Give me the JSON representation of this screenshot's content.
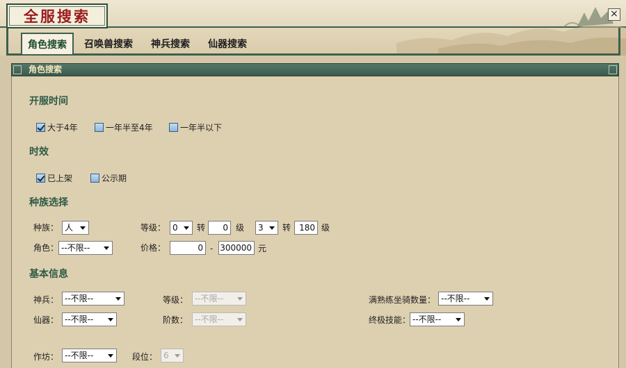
{
  "header": {
    "title": "全服搜索"
  },
  "tabs": [
    {
      "label": "角色搜索",
      "active": true
    },
    {
      "label": "召唤兽搜索",
      "active": false
    },
    {
      "label": "神兵搜索",
      "active": false
    },
    {
      "label": "仙器搜索",
      "active": false
    }
  ],
  "section": {
    "title": "角色搜索"
  },
  "open_time": {
    "title": "开服时间",
    "options": [
      {
        "label": "大于4年",
        "checked": true
      },
      {
        "label": "一年半至4年",
        "checked": false
      },
      {
        "label": "一年半以下",
        "checked": false
      }
    ]
  },
  "validity": {
    "title": "时效",
    "options": [
      {
        "label": "已上架",
        "checked": true
      },
      {
        "label": "公示期",
        "checked": false
      }
    ]
  },
  "race_select": {
    "title": "种族选择",
    "race_label": "种族：",
    "race_value": "人",
    "level_label": "等级：",
    "level_from_turn": "0",
    "turn_text": "转",
    "level_from": "0",
    "grade_text": "级",
    "level_to_turn": "3",
    "level_to": "180",
    "role_label": "角色：",
    "role_value": "--不限--",
    "price_label": "价格：",
    "price_min": "0",
    "price_sep": "-",
    "price_max": "300000",
    "currency": "元"
  },
  "basic_info": {
    "title": "基本信息",
    "weapon_label": "神兵：",
    "weapon_value": "--不限--",
    "weapon_level_label": "等级：",
    "weapon_level_value": "--不限--",
    "mount_label": "满熟练坐骑数量：",
    "mount_value": "--不限--",
    "artifact_label": "仙器：",
    "artifact_value": "--不限--",
    "artifact_stage_label": "阶数：",
    "artifact_stage_value": "--不限--",
    "skill_label": "终极技能：",
    "skill_value": "--不限--",
    "workshop_label": "作坊：",
    "workshop_value": "--不限--",
    "rank_label": "段位：",
    "rank_value": "6"
  },
  "colors": {
    "frame": "#3f5f4c",
    "title_red": "#9a1c1c",
    "group_green": "#2f5a46",
    "panel_bg": "#ddd0b0"
  }
}
